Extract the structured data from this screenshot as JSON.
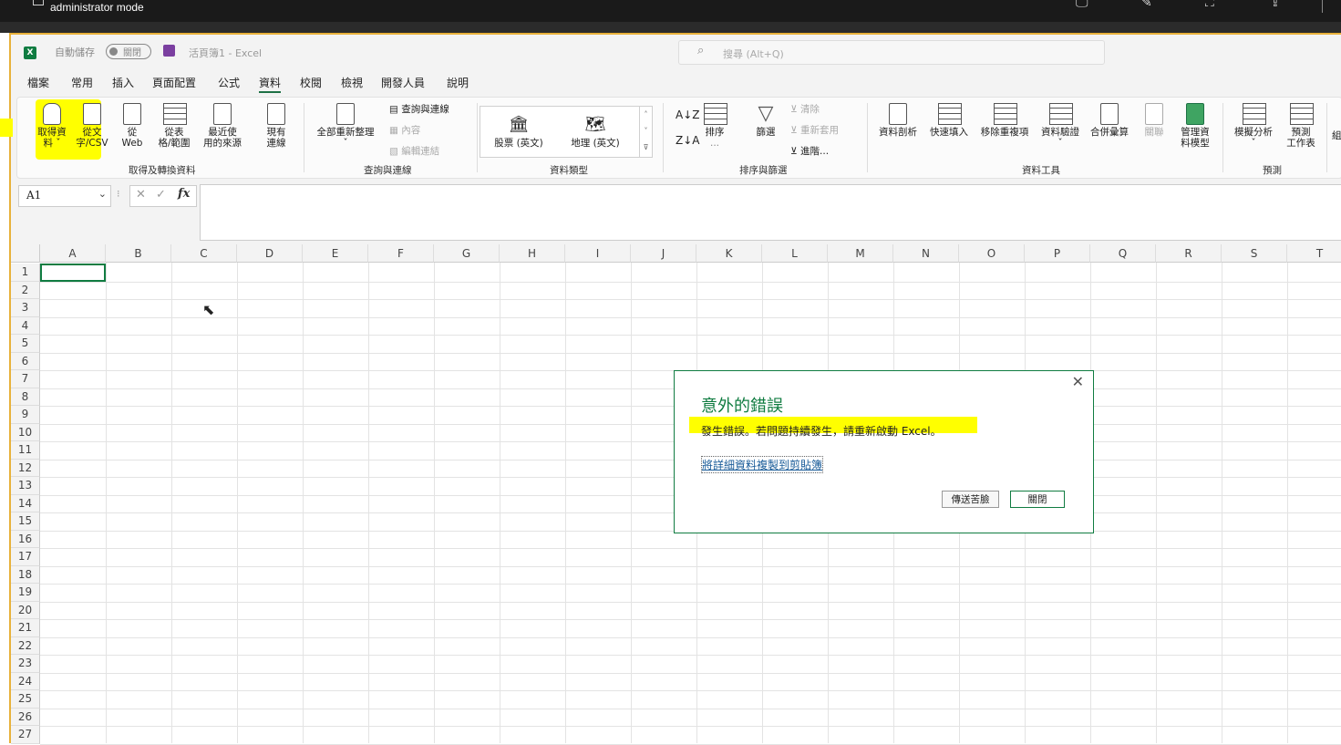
{
  "remote": {
    "title": "administrator mode"
  },
  "titlebar": {
    "app_icon": "X",
    "autosave_label": "自動儲存",
    "autosave_state": "關閉",
    "doc_title": "活頁簿1 - Excel",
    "search_placeholder": "搜尋 (Alt+Q)"
  },
  "menus": [
    "檔案",
    "常用",
    "插入",
    "頁面配置",
    "公式",
    "資料",
    "校閱",
    "檢視",
    "開發人員",
    "說明"
  ],
  "ribbon": {
    "get_data": {
      "btn1_l1": "取得資",
      "btn1_l2": "料 ˇ",
      "btn2_l1": "從文",
      "btn2_l2": "字/CSV",
      "btn3_l1": "從",
      "btn3_l2": "Web",
      "btn4_l1": "從表",
      "btn4_l2": "格/範圍",
      "btn5_l1": "最近使",
      "btn5_l2": "用的來源",
      "btn6_l1": "現有",
      "btn6_l2": "連線",
      "label": "取得及轉換資料"
    },
    "queries": {
      "refresh_all": "全部重新整理",
      "refresh_arrow": "ˇ",
      "queries_conn": "查詢與連線",
      "properties": "內容",
      "edit_links": "編輯連結",
      "label": "查詢與連線"
    },
    "data_types": {
      "stocks": "股票 (英文)",
      "geo": "地理 (英文)",
      "label": "資料類型"
    },
    "sort": {
      "az": "A↓Z",
      "za": "Z↓A",
      "sort": "排序",
      "filter": "篩選",
      "clear": "清除",
      "reapply": "重新套用",
      "advanced": "進階...",
      "more": "...",
      "label": "排序與篩選"
    },
    "tools": {
      "text_to_col": "資料剖析",
      "flash_fill": "快速填入",
      "remove_dup": "移除重複項",
      "validation": "資料驗證",
      "validation_arrow": "ˇ",
      "consolidate": "合併彙算",
      "relationships": "關聯",
      "model_l1": "管理資",
      "model_l2": "料模型",
      "label": "資料工具"
    },
    "forecast": {
      "whatif": "模擬分析",
      "whatif_arrow": "ˇ",
      "sheet_l1": "預測",
      "sheet_l2": "工作表",
      "label": "預測",
      "group_cut": "組"
    }
  },
  "formula": {
    "namebox": "A1",
    "fx": "fx",
    "value": ""
  },
  "columns": [
    "A",
    "B",
    "C",
    "D",
    "E",
    "F",
    "G",
    "H",
    "I",
    "J",
    "K",
    "L",
    "M",
    "N",
    "O",
    "P",
    "Q",
    "R",
    "S",
    "T"
  ],
  "rows": [
    "1",
    "2",
    "3",
    "4",
    "5",
    "6",
    "7",
    "8",
    "9",
    "10",
    "11",
    "12",
    "13",
    "14",
    "15",
    "16",
    "17",
    "18",
    "19",
    "20",
    "21",
    "22",
    "23",
    "24",
    "25",
    "26",
    "27"
  ],
  "dialog": {
    "title": "意外的錯誤",
    "message": "發生錯誤。若問題持續發生，請重新啟動 Excel。",
    "link": "將詳細資料複製到剪貼簿",
    "send_frown": "傳送苦臉",
    "close": "關閉"
  },
  "colors": {
    "accent": "#107c41",
    "highlight": "#ffff00",
    "frame": "#e8b13a"
  }
}
